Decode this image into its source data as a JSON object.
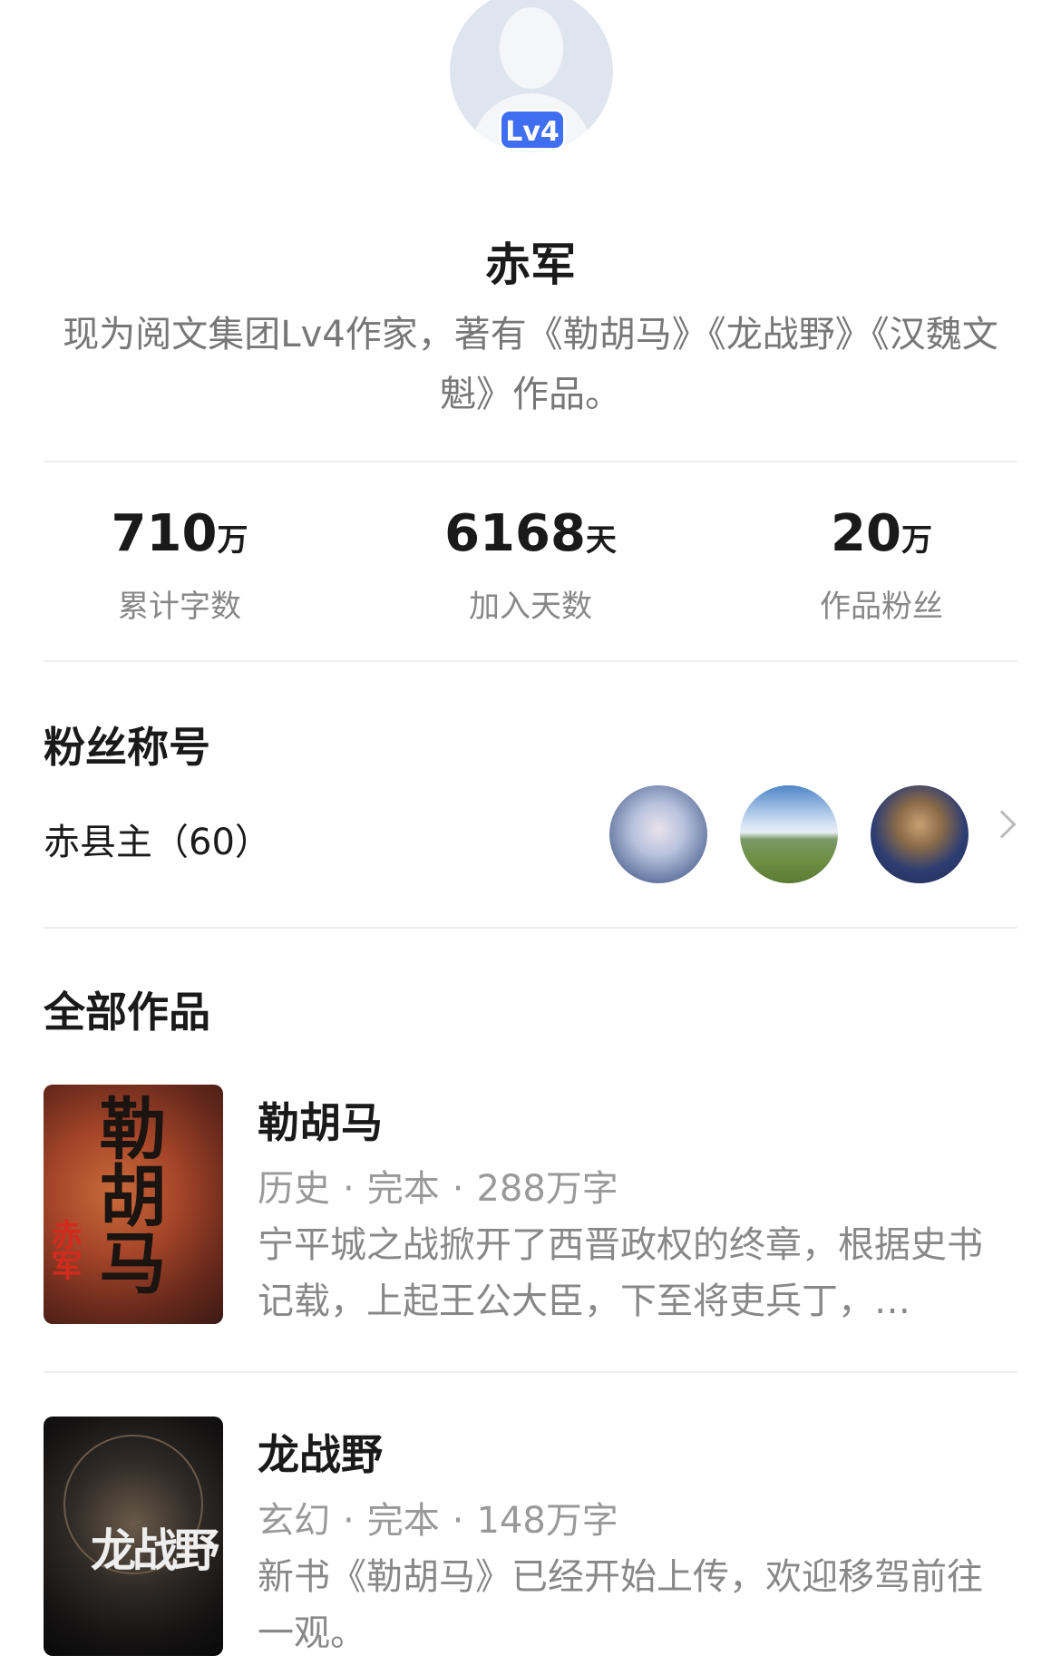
{
  "profile": {
    "level_badge": "Lv4",
    "name": "赤军",
    "intro": "现为阅文集团Lv4作家，著有《勒胡马》《龙战野》《汉魏文魁》作品。"
  },
  "stats": [
    {
      "value": "710",
      "unit": "万",
      "label": "累计字数"
    },
    {
      "value": "6168",
      "unit": "天",
      "label": "加入天数"
    },
    {
      "value": "20",
      "unit": "万",
      "label": "作品粉丝"
    }
  ],
  "fan_title": {
    "heading": "粉丝称号",
    "title_text": "赤县主（60）"
  },
  "works": {
    "heading": "全部作品",
    "items": [
      {
        "title": "勒胡马",
        "genre": "历史",
        "status": "完本",
        "word_count": "288万字",
        "description": "宁平城之战掀开了西晋政权的终章，根据史书记载，上起王公大臣，下至将吏兵丁，…",
        "cover_title": "勒胡马",
        "cover_author": "赤军"
      },
      {
        "title": "龙战野",
        "genre": "玄幻",
        "status": "完本",
        "word_count": "148万字",
        "description": "新书《勒胡马》已经开始上传，欢迎移驾前往一观。",
        "cover_title": "龙战野"
      }
    ]
  }
}
